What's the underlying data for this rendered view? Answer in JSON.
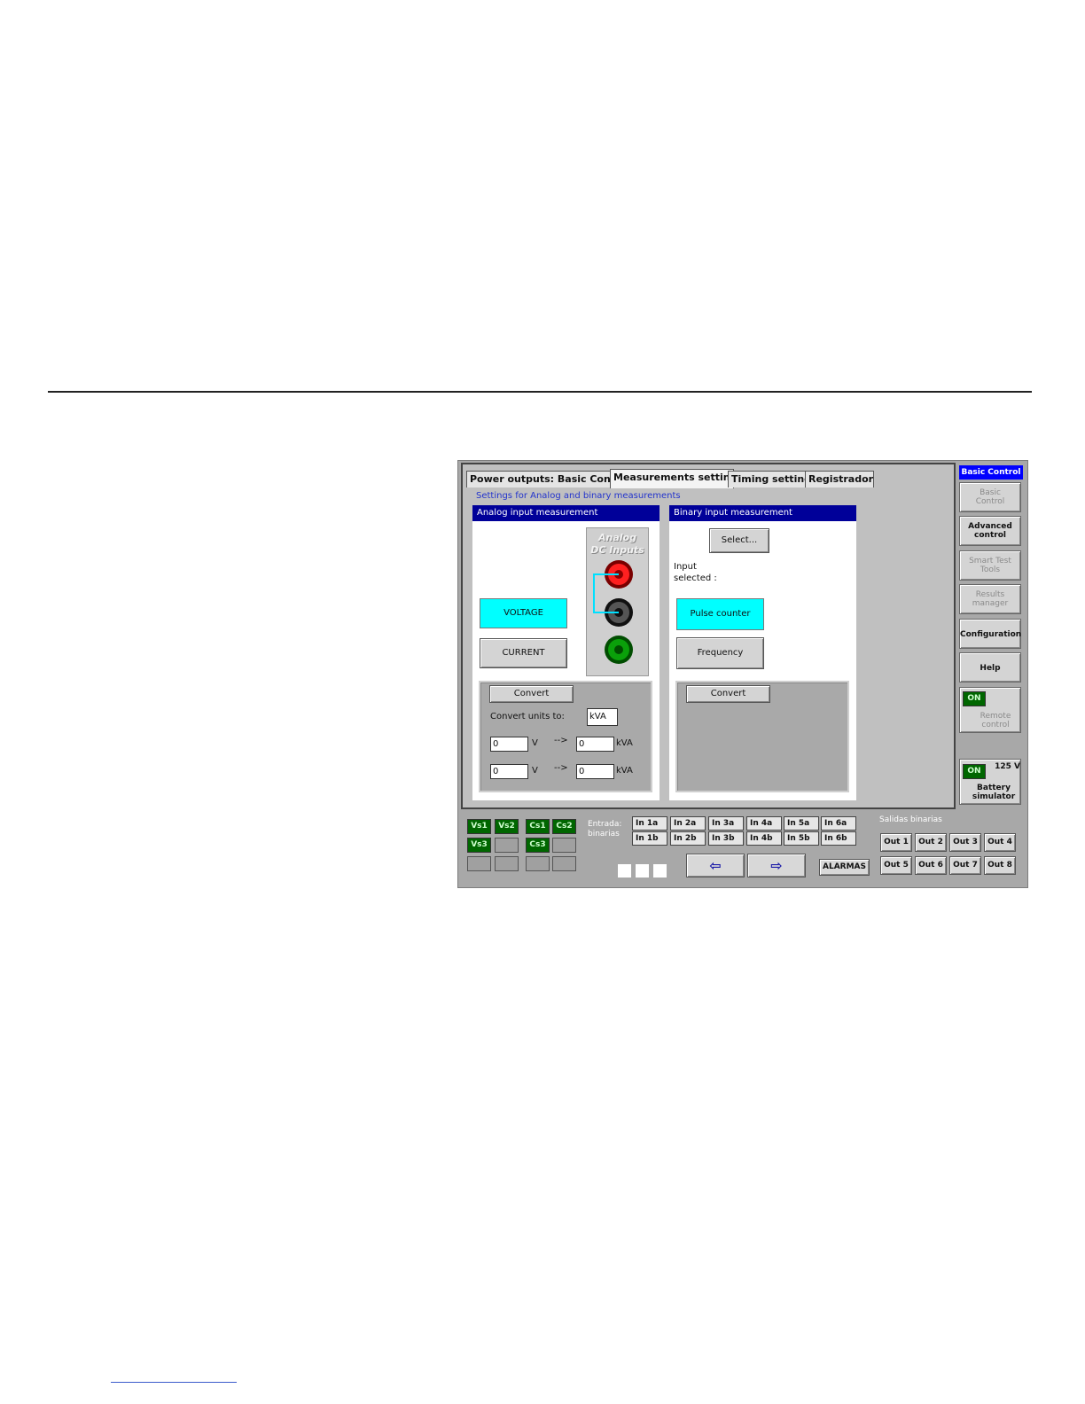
{
  "tabs": [
    "Power outputs: Basic Control",
    "Measurements settings",
    "Timing settings",
    "Registrador"
  ],
  "subtitle": "Settings for Analog and binary measurements",
  "analog": {
    "header": "Analog input measurement",
    "voltage_label": "VOLTAGE",
    "current_label": "CURRENT",
    "panel_title_1": "Analog",
    "panel_title_2": "DC Inputs",
    "convert_button": "Convert",
    "convert_units_label": "Convert units to:",
    "convert_units_value": "kVA",
    "row1": {
      "in_value": "0",
      "in_unit": "V",
      "arrow": "-->",
      "out_value": "0",
      "out_unit": "kVA"
    },
    "row2": {
      "in_value": "0",
      "in_unit": "V",
      "arrow": "-->",
      "out_value": "0",
      "out_unit": "kVA"
    }
  },
  "binary": {
    "header": "Binary input measurement",
    "select_button": "Select...",
    "input_selected_1": "Input",
    "input_selected_2": "selected :",
    "pulse_counter_label": "Pulse counter",
    "frequency_label": "Frequency",
    "convert_button": "Convert"
  },
  "sidebar": {
    "title": "Basic Control",
    "items": [
      {
        "l1": "Basic",
        "l2": "Control"
      },
      {
        "l1": "Advanced",
        "l2": "control"
      },
      {
        "l1": "Smart Test",
        "l2": "Tools"
      },
      {
        "l1": "Results",
        "l2": "manager"
      },
      {
        "l1": "Configuration",
        "l2": ""
      },
      {
        "l1": "Help",
        "l2": ""
      }
    ],
    "remote": {
      "status": "ON",
      "l1": "Remote",
      "l2": "control"
    },
    "battery": {
      "status": "ON",
      "voltage": "125 V",
      "l1": "Battery",
      "l2": "simulator"
    }
  },
  "indicators": {
    "vs1": "Vs1",
    "vs2": "Vs2",
    "vs3": "Vs3",
    "cs1": "Cs1",
    "cs2": "Cs2",
    "cs3": "Cs3"
  },
  "entradas": {
    "l1": "Entrada:",
    "l2": "binarias"
  },
  "inputs": [
    "In 1a",
    "In 2a",
    "In 3a",
    "In 4a",
    "In 5a",
    "In 6a",
    "In 1b",
    "In 2b",
    "In 3b",
    "In 4b",
    "In 5b",
    "In 6b"
  ],
  "salidas_label": "Salidas binarias",
  "outputs": [
    "Out 1",
    "Out 2",
    "Out 3",
    "Out 4",
    "Out 5",
    "Out 6",
    "Out 7",
    "Out 8"
  ],
  "alarmas_label": "ALARMAS",
  "nav": {
    "back_icon": "⇦",
    "forward_icon": "⇨"
  },
  "colors": {
    "header": "#000099",
    "cyan": "#00ffff",
    "indicator_on": "#006600",
    "accent_title": "#0000ff"
  }
}
